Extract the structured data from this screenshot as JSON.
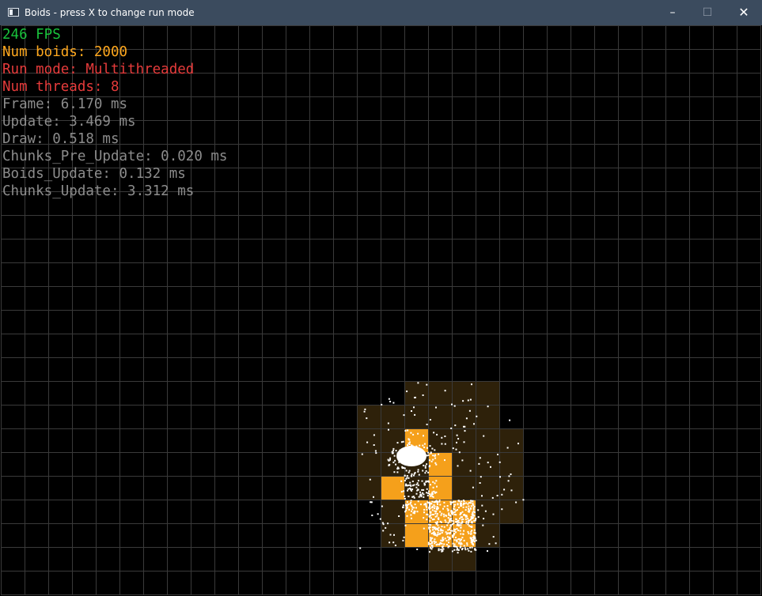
{
  "window": {
    "title": "Boids - press X to change run mode",
    "icon": "app-window-icon",
    "controls": {
      "minimize": "–",
      "maximize": "☐",
      "close": "✕"
    }
  },
  "hud": {
    "fps": "246 FPS",
    "num_boids": "Num boids: 2000",
    "run_mode": "Run mode: Multithreaded",
    "num_threads": "Num threads: 8",
    "frame": "Frame: 6.170 ms",
    "update": "Update: 3.469 ms",
    "draw": "Draw: 0.518 ms",
    "chunks_pre_update": "Chunks_Pre_Update: 0.020 ms",
    "boids_update": "Boids_Update: 0.132 ms",
    "chunks_update": "Chunks_Update: 3.312 ms"
  },
  "colors": {
    "background": "#000000",
    "titlebar": "#3b4b5e",
    "grid": "#3a3a3a",
    "fps": "#19c33c",
    "num_boids": "#ffa81e",
    "run_mode": "#e63b3b",
    "num_threads": "#e63b3b",
    "stats": "#8c8c8c",
    "chunk_dim": "#2e210a",
    "chunk_bright": "#f5a01b",
    "boid": "#ffffff"
  }
}
